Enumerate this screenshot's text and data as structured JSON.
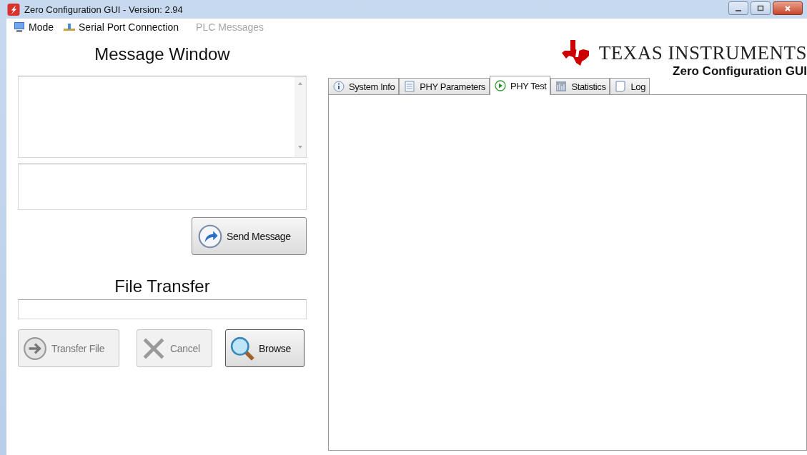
{
  "window": {
    "title": "Zero Configuration GUI - Version: 2.94"
  },
  "menu": [
    {
      "label": "Mode",
      "disabled": false
    },
    {
      "label": "Serial Port Connection",
      "disabled": false
    },
    {
      "label": "PLC Messages",
      "disabled": true
    }
  ],
  "message_window": {
    "heading": "Message Window",
    "send_button": {
      "label": "Send Message",
      "disabled": false
    }
  },
  "file_transfer": {
    "heading": "File Transfer",
    "buttons": [
      {
        "label": "Transfer File",
        "disabled": true
      },
      {
        "label": "Cancel",
        "disabled": true
      },
      {
        "label": "Browse",
        "disabled": false
      }
    ]
  },
  "brand": {
    "name": "TEXAS INSTRUMENTS",
    "subtitle": "Zero Configuration GUI"
  },
  "tabs": [
    {
      "label": "System Info",
      "selected": false
    },
    {
      "label": "PHY Parameters",
      "selected": false
    },
    {
      "label": "PHY Test",
      "selected": true
    },
    {
      "label": "Statistics",
      "selected": false
    },
    {
      "label": "Log",
      "selected": false
    }
  ]
}
